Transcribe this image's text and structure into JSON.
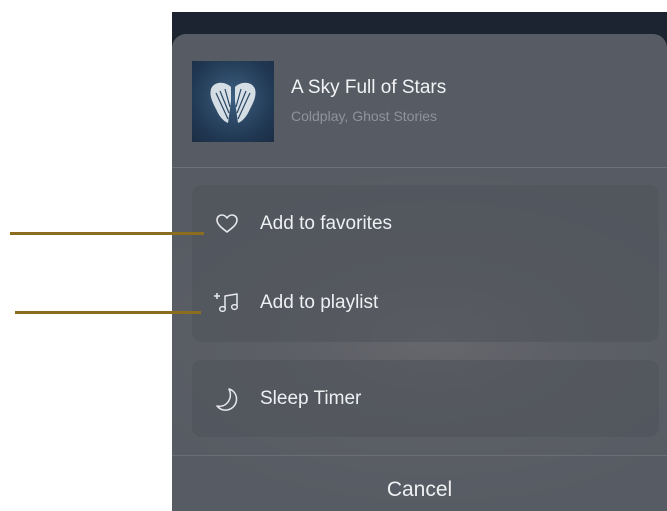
{
  "song": {
    "title": "A Sky Full of Stars",
    "subtitle": "Coldplay, Ghost Stories",
    "artwork_icon": "album-art-wings"
  },
  "menu": {
    "items": [
      {
        "label": "Add to favorites",
        "icon": "heart-icon"
      },
      {
        "label": "Add to playlist",
        "icon": "add-to-playlist-icon"
      },
      {
        "label": "Sleep Timer",
        "icon": "moon-icon"
      }
    ],
    "cancel_label": "Cancel"
  },
  "colors": {
    "sheet_background": "#5a5e65",
    "text_primary": "#eef0f2",
    "text_secondary": "#8d949d",
    "callout_line": "#8a6d1e"
  }
}
